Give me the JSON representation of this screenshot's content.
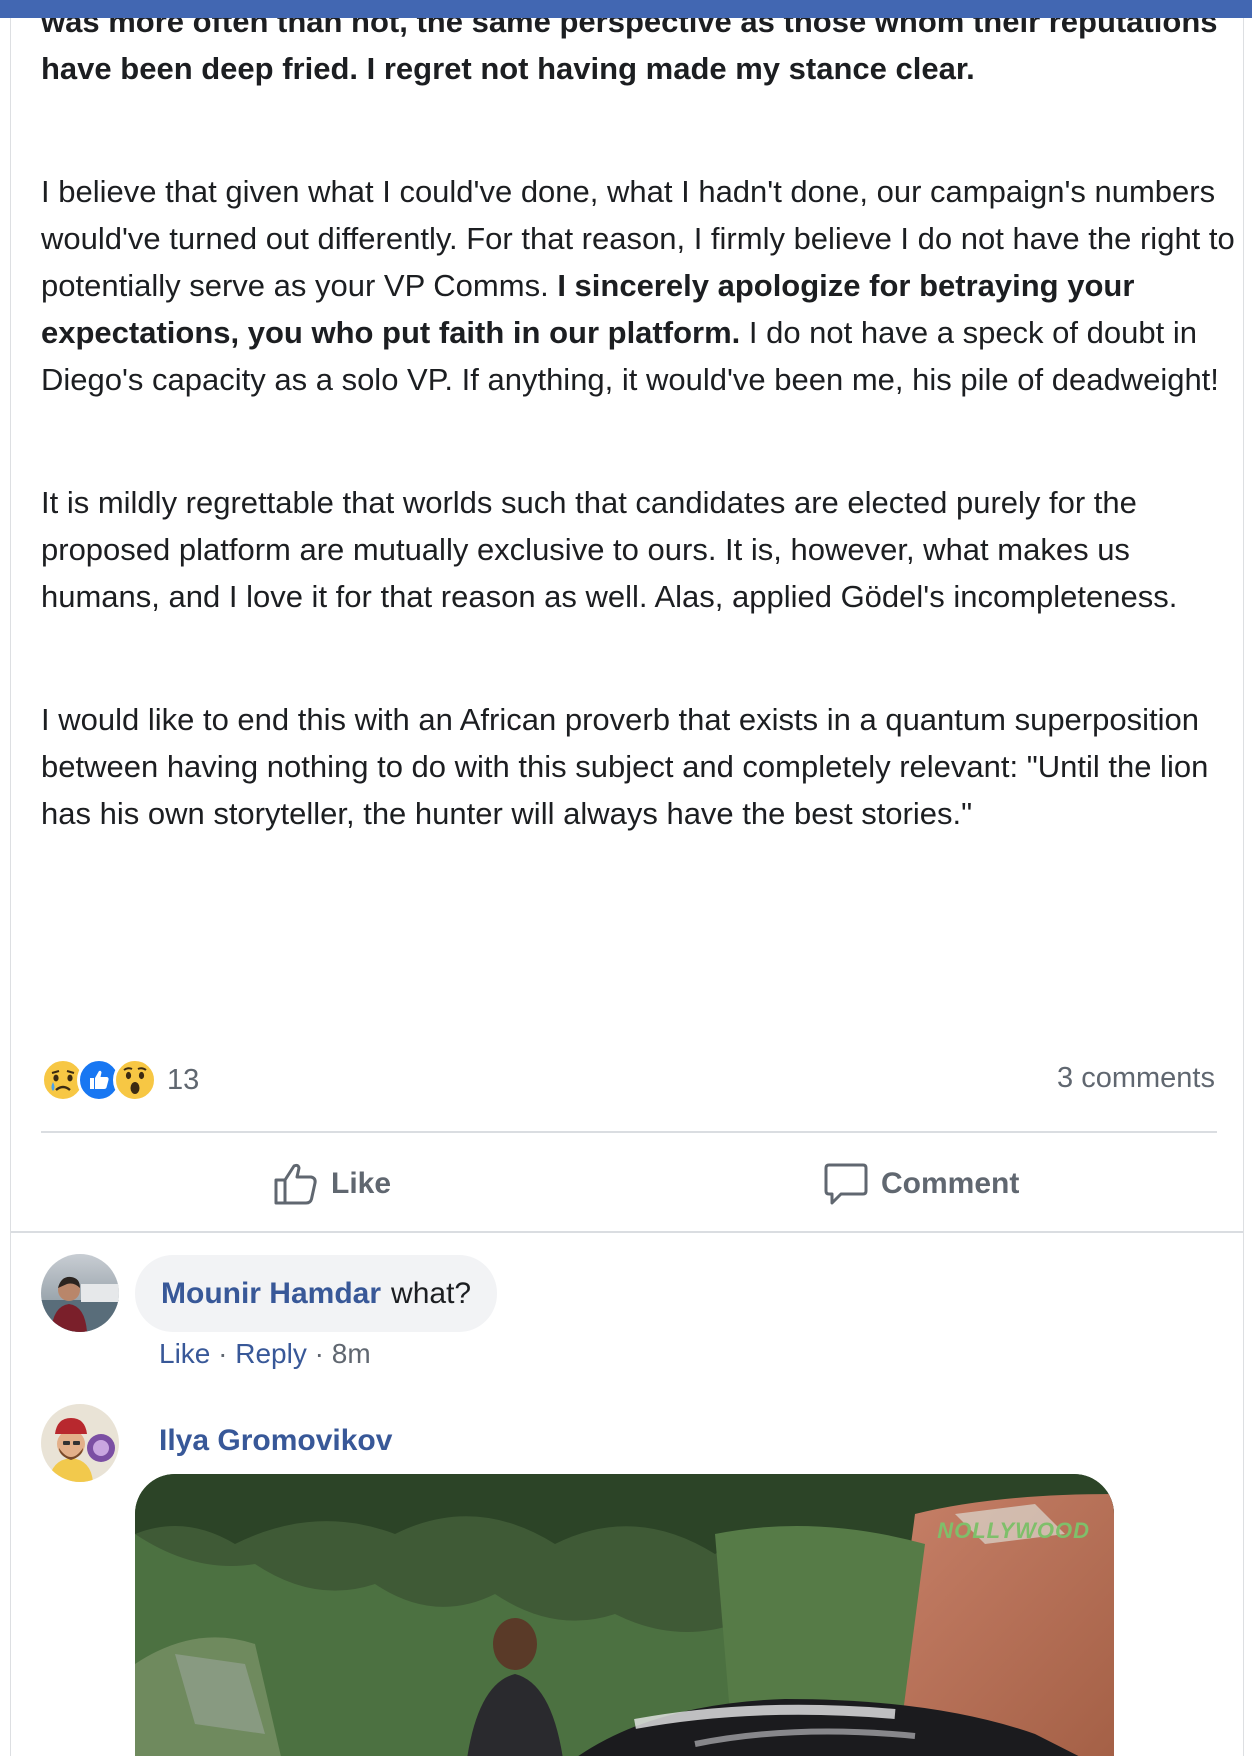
{
  "post": {
    "paragraph1": "was more often than not, the same perspective as those whom their reputations have been deep fried. I regret not having made my stance clear.",
    "paragraph2_a": "I believe that given what I could've done, what I hadn't done, our campaign's numbers would've turned out differently. For that reason, I firmly believe I do not have the right to potentially serve as your VP Comms. ",
    "paragraph2_bold": "I sincerely apologize for betraying your expectations, you who put faith in our platform.",
    "paragraph2_b": " I do not have a speck of doubt in Diego's capacity as a solo VP. If anything, it would've been me, his pile of deadweight!",
    "paragraph3": "It is mildly regrettable that worlds such that candidates are elected purely for the proposed platform are mutually exclusive to ours. It is, however, what makes us humans, and I love it for that reason as well. Alas, applied Gödel's incompleteness.",
    "paragraph4": "I would like to end this with an African proverb that exists in a quantum superposition between having nothing to do with this subject and completely relevant: \"Until the lion has his own storyteller, the hunter will always have the best stories.\""
  },
  "reactions": {
    "icons": [
      "sad-icon",
      "like-icon",
      "wow-icon"
    ],
    "count": "13",
    "comments_label": "3 comments"
  },
  "actions": {
    "like_label": "Like",
    "comment_label": "Comment"
  },
  "comments": [
    {
      "author": "Mounir Hamdar",
      "text": "what?",
      "like_label": "Like",
      "separator": "·",
      "reply_label": "Reply",
      "time": "8m"
    },
    {
      "author": "Ilya Gromovikov",
      "attachment_watermark": "NOLLYWOOD"
    }
  ],
  "colors": {
    "link": "#385898",
    "topbar": "#4267b2",
    "muted": "#606770",
    "like_blue": "#1877f2",
    "emoji_yellow": "#f7c744"
  }
}
